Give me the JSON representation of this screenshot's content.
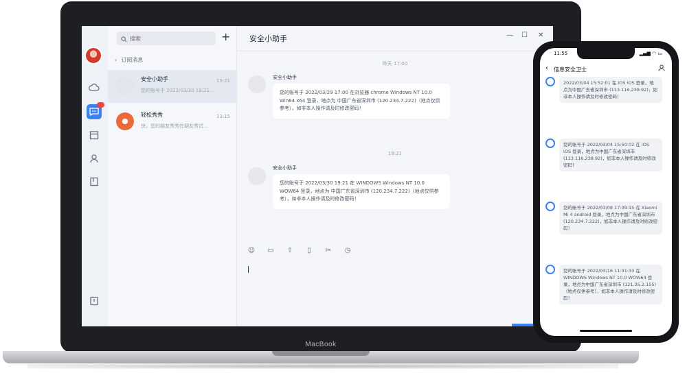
{
  "laptop": {
    "brand": "MacBook",
    "nav_icons": [
      "cloud-icon",
      "chat-icon",
      "calendar-icon",
      "contacts-icon",
      "notes-icon",
      "feedback-icon"
    ],
    "search": {
      "placeholder": "搜索"
    },
    "add_label": "+",
    "back_label": "订阅消息",
    "conversations": [
      {
        "title": "安全小助手",
        "time": "13:21",
        "snippet": "您的账号于 2022/03/30 19:21..."
      },
      {
        "title": "轻松秀秀",
        "time": "13:15",
        "snippet": "快，您的朋友秀秀在朋友秀试..."
      }
    ],
    "chat": {
      "title": "安全小助手",
      "messages": [
        {
          "time": "昨天 17:00",
          "sender": "安全小助手",
          "text": "您的账号于 2022/03/29 17:00 在浏览器 chrome Windows NT 10.0 Win64 x64 登录，地点为 中国广东省深圳市 (120.234.7.222)（地点仅供参考），如非本人操作请及时修改密码！"
        },
        {
          "time": "19:21",
          "sender": "安全小助手",
          "text": "您的账号于 2022/03/30 19:21 在 WINDOWS Windows NT 10.0 WOW64 登录，地点为 中国广东省深圳市 (120.234.7.222)（地点仅供参考），如非本人操作请及时修改密码！"
        }
      ]
    }
  },
  "phone": {
    "status_time": "11:55",
    "status_right": "▂▄▆ ◠ ▭",
    "header_title": "信息安全卫士",
    "messages": [
      {
        "text": "2022/03/04 15:52:01 在 iOS iOS 登录，地点为中国广东省深圳市 (113.116.238.92)，如非本人操作请及时修改密码！",
        "time": ""
      },
      {
        "text": "您的账号于 2022/03/04 15:50:02 在 iOS iOS 登录，地点为中国广东省深圳市 (113.116.238.92)，如非本人操作请及时修改密码！",
        "time": ""
      },
      {
        "text": "您的账号于 2022/03/08 17:09:15 在 Xiaomi Mi 4 android 登录，地点为中国广东省深圳市 (120.234.7.222)，如非本人操作请及时修改密码！",
        "time": ""
      },
      {
        "text": "您的账号于 2022/03/16 11:01:33 在 WINDOWS Windows NT 10.0 WOW64 登录，地点为中国广东省深圳市 (121.35.2.155)（地点仅供参考），如非本人操作请及时修改密码！",
        "time": ""
      }
    ]
  }
}
